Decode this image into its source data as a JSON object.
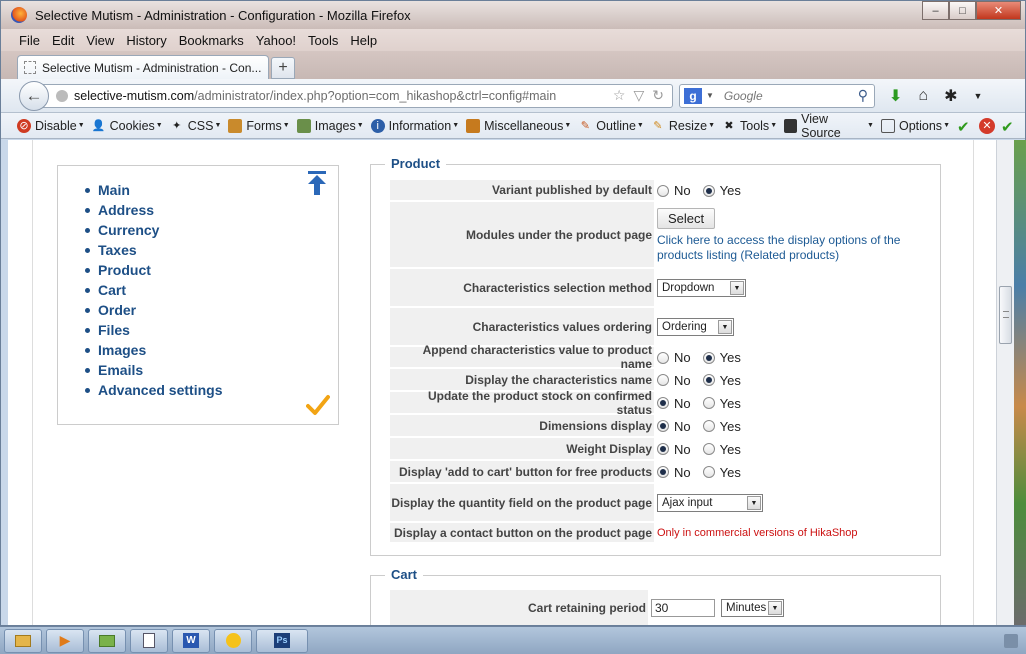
{
  "window": {
    "title": "Selective Mutism - Administration - Configuration - Mozilla Firefox",
    "controls": {
      "minimize": "–",
      "maximize": "□",
      "close": "✕"
    }
  },
  "menubar": [
    "File",
    "Edit",
    "View",
    "History",
    "Bookmarks",
    "Yahoo!",
    "Tools",
    "Help"
  ],
  "tab": {
    "title": "Selective Mutism - Administration - Con...",
    "new_tab": "+"
  },
  "navbar": {
    "back": "←",
    "url_host": "selective-mutism.com",
    "url_path": "/administrator/index.php?option=com_hikashop&ctrl=config#main",
    "search_engine_badge": "g",
    "search_placeholder": "Google"
  },
  "webdev_toolbar": [
    "Disable",
    "Cookies",
    "CSS",
    "Forms",
    "Images",
    "Information",
    "Miscellaneous",
    "Outline",
    "Resize",
    "Tools",
    "View Source",
    "Options"
  ],
  "sidemenu": {
    "items": [
      "Main",
      "Address",
      "Currency",
      "Taxes",
      "Product",
      "Cart",
      "Order",
      "Files",
      "Images",
      "Emails",
      "Advanced settings"
    ]
  },
  "product": {
    "legend": "Product",
    "no": "No",
    "yes": "Yes",
    "variant_published": {
      "label": "Variant published by default",
      "value": "Yes"
    },
    "modules": {
      "label": "Modules under the product page",
      "button": "Select",
      "link_line1": "Click here to access the display options of the",
      "link_line2": "products listing (Related products)"
    },
    "char_selection": {
      "label": "Characteristics selection method",
      "value": "Dropdown"
    },
    "char_ordering": {
      "label": "Characteristics values ordering",
      "value": "Ordering"
    },
    "append_char": {
      "label": "Append characteristics value to product name",
      "value": "Yes"
    },
    "display_char_name": {
      "label": "Display the characteristics name",
      "value": "Yes"
    },
    "update_stock": {
      "label": "Update the product stock on confirmed status",
      "value": "No"
    },
    "dimensions": {
      "label": "Dimensions display",
      "value": "No"
    },
    "weight": {
      "label": "Weight Display",
      "value": "No"
    },
    "add_to_cart_free": {
      "label": "Display 'add to cart' button for free products",
      "value": "No"
    },
    "quantity_field": {
      "label": "Display the quantity field on the product page",
      "value": "Ajax input"
    },
    "contact_button": {
      "label": "Display a contact button on the product page",
      "note": "Only in commercial versions of HikaShop"
    }
  },
  "cart": {
    "legend": "Cart",
    "retaining_period": {
      "label": "Cart retaining period",
      "value": "30",
      "unit": "Minutes"
    }
  },
  "taskbar": {
    "photoshop_label": "Ps"
  }
}
